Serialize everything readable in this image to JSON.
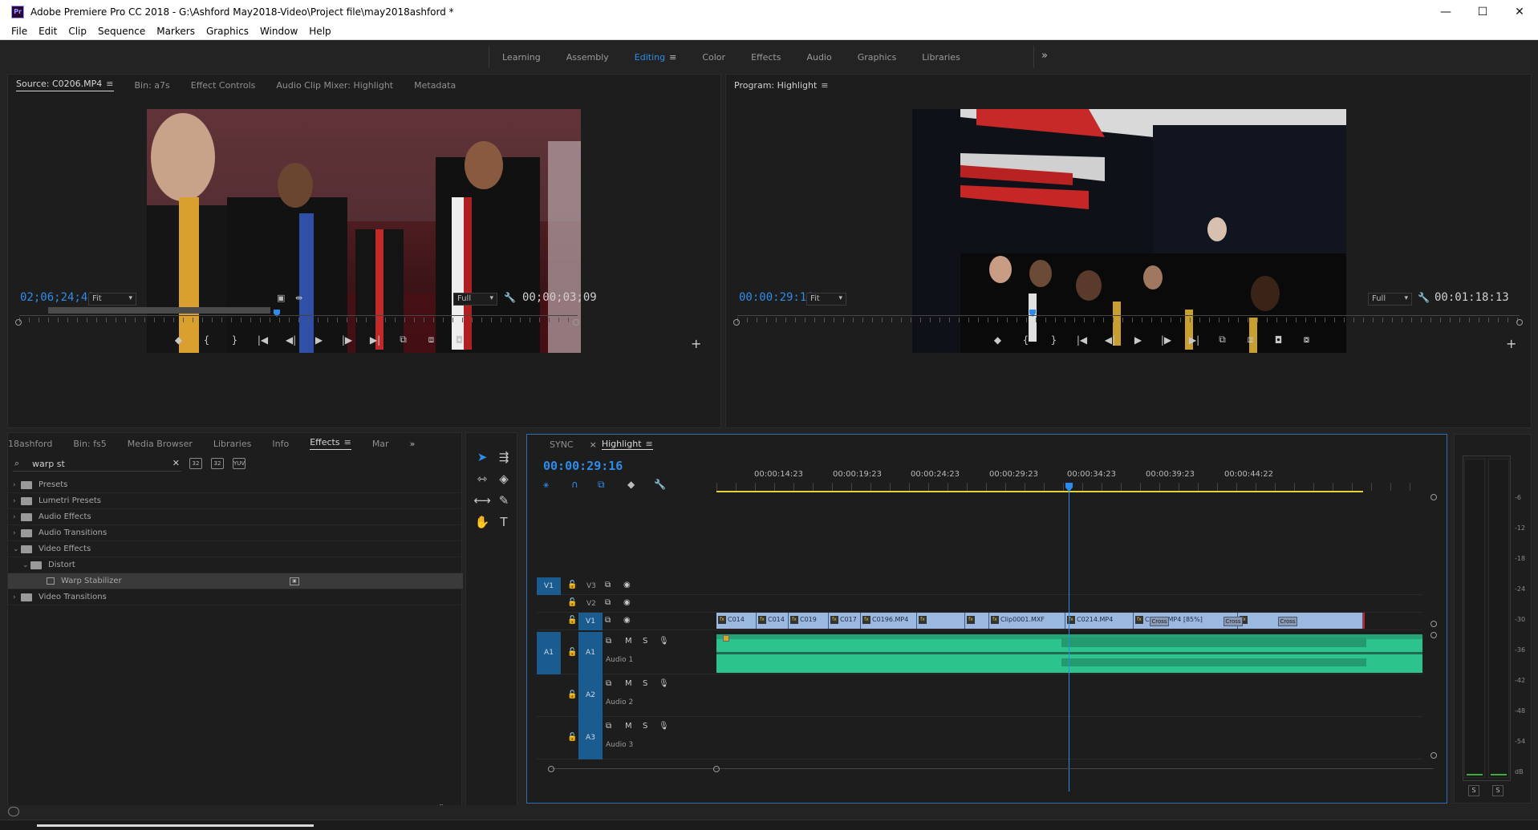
{
  "window": {
    "title": "Adobe Premiere Pro CC 2018 - G:\\Ashford May2018-Video\\Project file\\may2018ashford *",
    "app_badge": "Pr",
    "minimize": "—",
    "maximize": "☐",
    "close": "✕"
  },
  "menu": [
    "File",
    "Edit",
    "Clip",
    "Sequence",
    "Markers",
    "Graphics",
    "Window",
    "Help"
  ],
  "workspaces": {
    "tabs": [
      "Learning",
      "Assembly",
      "Editing",
      "Color",
      "Effects",
      "Audio",
      "Graphics",
      "Libraries"
    ],
    "active": "Editing",
    "more": "»"
  },
  "source_monitor": {
    "tabs": [
      "Source: C0206.MP4",
      "Bin: a7s",
      "Effect Controls",
      "Audio Clip Mixer: Highlight",
      "Metadata"
    ],
    "current_tc": "02;06;24;49",
    "fit": "Fit",
    "quality": "Full",
    "duration_tc": "00;00;03;09",
    "controls": [
      "◆",
      "{",
      "}",
      "|◀",
      "◀|",
      "▶",
      "|▶",
      "▶|",
      "⧉",
      "⧈",
      "◘"
    ]
  },
  "program_monitor": {
    "title": "Program: Highlight",
    "current_tc": "00:00:29:16",
    "fit": "Fit",
    "quality": "Full",
    "duration_tc": "00:01:18:13",
    "controls": [
      "◆",
      "{",
      "}",
      "|◀",
      "◀|",
      "▶",
      "|▶",
      "▶|",
      "⧉",
      "⧈",
      "◘",
      "⧇"
    ]
  },
  "effects_panel": {
    "tabs": [
      "18ashford",
      "Bin: fs5",
      "Media Browser",
      "Libraries",
      "Info",
      "Effects",
      "Mar"
    ],
    "active": "Effects",
    "search_value": "warp st",
    "filter_buttons": [
      "32",
      "32",
      "YUV"
    ],
    "tree": [
      {
        "label": "Presets",
        "indent": 0,
        "expanded": false
      },
      {
        "label": "Lumetri Presets",
        "indent": 0,
        "expanded": false
      },
      {
        "label": "Audio Effects",
        "indent": 0,
        "expanded": false
      },
      {
        "label": "Audio Transitions",
        "indent": 0,
        "expanded": false
      },
      {
        "label": "Video Effects",
        "indent": 0,
        "expanded": true
      },
      {
        "label": "Distort",
        "indent": 1,
        "expanded": true
      },
      {
        "label": "Warp Stabilizer",
        "indent": 2,
        "selected": true
      },
      {
        "label": "Video Transitions",
        "indent": 0,
        "expanded": false
      }
    ]
  },
  "timeline": {
    "tabs": [
      "SYNC",
      "Highlight"
    ],
    "active": "Highlight",
    "current_tc": "00:00:29:16",
    "ruler": [
      "00:00:14:23",
      "00:00:19:23",
      "00:00:24:23",
      "00:00:29:23",
      "00:00:34:23",
      "00:00:39:23",
      "00:00:44:22"
    ],
    "video_tracks": [
      {
        "target": "V1",
        "name": "V3"
      },
      {
        "target": "",
        "name": "V2"
      },
      {
        "target": "",
        "name": "V1"
      }
    ],
    "audio_tracks": [
      {
        "target": "A1",
        "name": "A1",
        "label": "Audio 1"
      },
      {
        "target": "",
        "name": "A2",
        "label": "Audio 2"
      },
      {
        "target": "",
        "name": "A3",
        "label": "Audio 3"
      }
    ],
    "clips": [
      {
        "label": "C014"
      },
      {
        "label": "C014"
      },
      {
        "label": "C019"
      },
      {
        "label": "C017"
      },
      {
        "label": "C0196.MP4"
      },
      {
        "label": ""
      },
      {
        "label": ""
      },
      {
        "label": "Clip0001.MXF"
      },
      {
        "label": "C0214.MP4"
      },
      {
        "label": "C0212.MP4 [85%]"
      },
      {
        "label": ""
      }
    ],
    "transitions": [
      "Cross",
      "Cross",
      "Cross"
    ],
    "track_buttons": {
      "mute": "M",
      "solo": "S"
    }
  },
  "meters": {
    "db_labels": [
      "-6",
      "-12",
      "-18",
      "-24",
      "-30",
      "-36",
      "-42",
      "-48",
      "-54",
      "dB"
    ],
    "solo_left": "S",
    "solo_right": "S"
  }
}
